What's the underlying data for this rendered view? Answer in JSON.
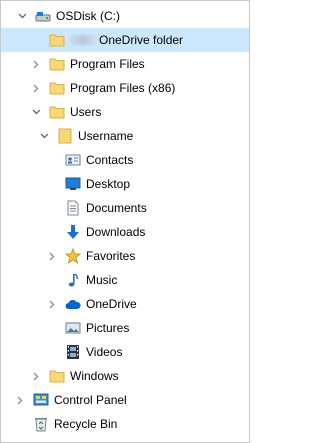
{
  "tree": {
    "drive": {
      "label": "OSDisk (C:)",
      "icon": "hard-drive-icon"
    },
    "onedrive_folder": {
      "label": "OneDrive folder",
      "icon": "folder-icon"
    },
    "program_files": {
      "label": "Program Files",
      "icon": "folder-icon"
    },
    "program_files_x86": {
      "label": "Program Files (x86)",
      "icon": "folder-icon"
    },
    "users": {
      "label": "Users",
      "icon": "folder-icon"
    },
    "username": {
      "label": "Username",
      "icon": "folder-icon"
    },
    "contacts": {
      "label": "Contacts",
      "icon": "contacts-icon"
    },
    "desktop": {
      "label": "Desktop",
      "icon": "desktop-icon"
    },
    "documents": {
      "label": "Documents",
      "icon": "documents-icon"
    },
    "downloads": {
      "label": "Downloads",
      "icon": "download-icon"
    },
    "favorites": {
      "label": "Favorites",
      "icon": "star-icon"
    },
    "music": {
      "label": "Music",
      "icon": "music-note-icon"
    },
    "onedrive": {
      "label": "OneDrive",
      "icon": "cloud-icon"
    },
    "pictures": {
      "label": "Pictures",
      "icon": "pictures-icon"
    },
    "videos": {
      "label": "Videos",
      "icon": "film-icon"
    },
    "windows": {
      "label": "Windows",
      "icon": "folder-icon"
    },
    "control_panel": {
      "label": "Control Panel",
      "icon": "control-panel-icon"
    },
    "recycle_bin": {
      "label": "Recycle Bin",
      "icon": "recycle-bin-icon"
    }
  },
  "colors": {
    "selected_bg": "#cce8ff",
    "folder": "#f8d775",
    "accent": "#0078d7"
  }
}
